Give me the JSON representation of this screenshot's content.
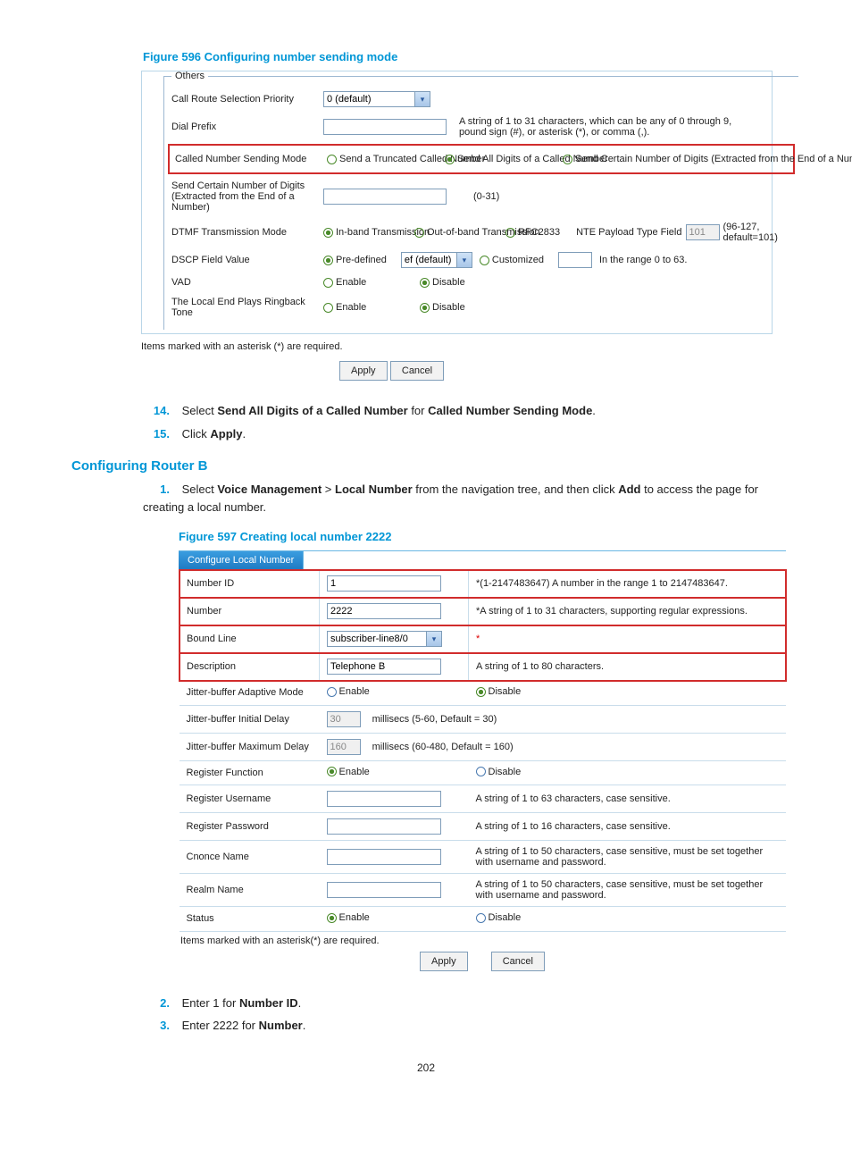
{
  "figure596": {
    "caption": "Figure 596 Configuring number sending mode",
    "legend": "Others",
    "rows": {
      "callRoute": {
        "label": "Call Route Selection Priority",
        "value": "0 (default)"
      },
      "dialPrefix": {
        "label": "Dial Prefix",
        "hint": "A string of 1 to 31 characters, which can be any of 0 through 9, pound sign (#), or asterisk (*), or comma (,)."
      },
      "calledNumberMode": {
        "label": "Called Number Sending Mode",
        "opt1": "Send a Truncated Called Number",
        "opt2": "Send All Digits of a Called Number",
        "opt3": "Send Certain Number of Digits (Extracted from the End of a Number)"
      },
      "sendCertain": {
        "label": "Send Certain Number of Digits (Extracted from the End of a Number)",
        "hint": "(0-31)"
      },
      "dtmf": {
        "label": "DTMF Transmission Mode",
        "opt1": "In-band Transmission",
        "opt2": "Out-of-band Transmission",
        "opt3": "RFC2833",
        "nteLabel": "NTE Payload Type Field",
        "nteValue": "101",
        "nteHint": "(96-127, default=101)"
      },
      "dscp": {
        "label": "DSCP Field Value",
        "opt1": "Pre-defined",
        "ddValue": "ef (default)",
        "opt2": "Customized",
        "hint": "In the range 0 to 63."
      },
      "vad": {
        "label": "VAD",
        "opt1": "Enable",
        "opt2": "Disable"
      },
      "ringback": {
        "label": "The Local End Plays Ringback Tone",
        "opt1": "Enable",
        "opt2": "Disable"
      }
    },
    "note": "Items marked with an asterisk (*) are required.",
    "apply": "Apply",
    "cancel": "Cancel"
  },
  "steps14_15": {
    "s14": {
      "num": "14.",
      "text_before": "Select ",
      "b1": "Send All Digits of a Called Number",
      "mid": " for ",
      "b2": "Called Number Sending Mode",
      "tail": "."
    },
    "s15": {
      "num": "15.",
      "text_before": "Click ",
      "b1": "Apply",
      "tail": "."
    }
  },
  "headingB": "Configuring Router B",
  "step1": {
    "num": "1.",
    "pre": "Select ",
    "b1": "Voice Management",
    "gt": " > ",
    "b2": "Local Number",
    "mid": " from the navigation tree, and then click ",
    "b3": "Add",
    "tail": " to access the page for creating a local number."
  },
  "figure597": {
    "caption": "Figure 597 Creating local number 2222",
    "tab": "Configure Local Number",
    "rows": {
      "numberId": {
        "label": "Number ID",
        "value": "1",
        "hint": "*(1-2147483647) A number in the range 1 to 2147483647."
      },
      "number": {
        "label": "Number",
        "value": "2222",
        "hint": "*A string of 1 to 31 characters, supporting regular expressions."
      },
      "boundLine": {
        "label": "Bound Line",
        "value": "subscriber-line8/0",
        "hint": "*"
      },
      "description": {
        "label": "Description",
        "value": "Telephone B",
        "hint": "A string of 1 to 80 characters."
      },
      "jitterAdaptive": {
        "label": "Jitter-buffer Adaptive Mode",
        "opt1": "Enable",
        "opt2": "Disable"
      },
      "jitterInitial": {
        "label": "Jitter-buffer Initial Delay",
        "value": "30",
        "hint": "millisecs (5-60, Default = 30)"
      },
      "jitterMax": {
        "label": "Jitter-buffer Maximum Delay",
        "value": "160",
        "hint": "millisecs (60-480, Default = 160)"
      },
      "regFunc": {
        "label": "Register Function",
        "opt1": "Enable",
        "opt2": "Disable"
      },
      "regUser": {
        "label": "Register Username",
        "hint": "A string of 1 to 63 characters, case sensitive."
      },
      "regPass": {
        "label": "Register Password",
        "hint": "A string of 1 to 16 characters, case sensitive."
      },
      "cnonce": {
        "label": "Cnonce Name",
        "hint": "A string of 1 to 50 characters, case sensitive, must be set together with username and password."
      },
      "realm": {
        "label": "Realm Name",
        "hint": "A string of 1 to 50 characters, case sensitive, must be set together with username and password."
      },
      "status": {
        "label": "Status",
        "opt1": "Enable",
        "opt2": "Disable"
      }
    },
    "note": "Items marked with an asterisk(*) are required.",
    "apply": "Apply",
    "cancel": "Cancel"
  },
  "steps2_3": {
    "s2": {
      "num": "2.",
      "pre": "Enter 1 for ",
      "b1": "Number ID",
      "tail": "."
    },
    "s3": {
      "num": "3.",
      "pre": "Enter 2222 for ",
      "b1": "Number",
      "tail": "."
    }
  },
  "pageNum": "202"
}
